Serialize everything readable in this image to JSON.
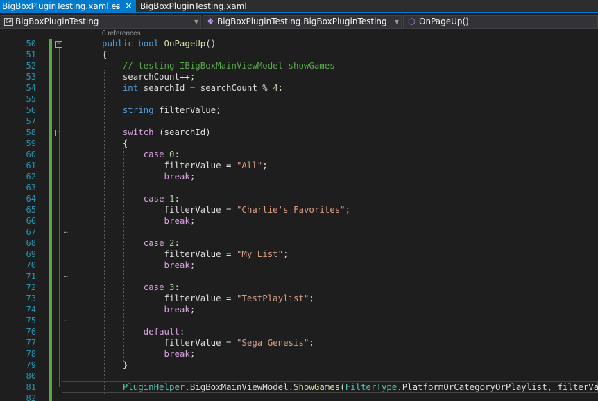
{
  "tabs": [
    {
      "label": "BigBoxPluginTesting.xaml.cs",
      "active": true,
      "pin_glyph": "⊸",
      "close_glyph": "✕"
    },
    {
      "label": "BigBoxPluginTesting.xaml",
      "active": false
    }
  ],
  "navbar": {
    "project": {
      "icon": "csharp-project-icon",
      "icon_text": "C#",
      "label": "BigBoxPluginTesting"
    },
    "type": {
      "icon": "class-icon",
      "label": "BigBoxPluginTesting.BigBoxPluginTesting"
    },
    "member": {
      "icon": "method-icon",
      "label": "OnPageUp()"
    }
  },
  "editor": {
    "references_label": "0 references",
    "lines": [
      {
        "n": "50",
        "tokens": [
          {
            "t": "public",
            "c": "kw"
          },
          {
            "t": " ",
            "c": "pl"
          },
          {
            "t": "bool",
            "c": "kw"
          },
          {
            "t": " ",
            "c": "pl"
          },
          {
            "t": "OnPageUp",
            "c": "fn"
          },
          {
            "t": "()",
            "c": "pl"
          }
        ]
      },
      {
        "n": "51",
        "tokens": [
          {
            "t": "{",
            "c": "pl"
          }
        ]
      },
      {
        "n": "52",
        "tokens": [
          {
            "t": "    // testing IBigBoxMainViewModel showGames",
            "c": "cm"
          }
        ]
      },
      {
        "n": "53",
        "tokens": [
          {
            "t": "    searchCount++;",
            "c": "pl"
          }
        ]
      },
      {
        "n": "54",
        "tokens": [
          {
            "t": "    ",
            "c": "pl"
          },
          {
            "t": "int",
            "c": "kw"
          },
          {
            "t": " searchId = searchCount % ",
            "c": "pl"
          },
          {
            "t": "4",
            "c": "num"
          },
          {
            "t": ";",
            "c": "pl"
          }
        ]
      },
      {
        "n": "55",
        "tokens": []
      },
      {
        "n": "56",
        "tokens": [
          {
            "t": "    ",
            "c": "pl"
          },
          {
            "t": "string",
            "c": "kw"
          },
          {
            "t": " filterValue;",
            "c": "pl"
          }
        ]
      },
      {
        "n": "57",
        "tokens": []
      },
      {
        "n": "58",
        "tokens": [
          {
            "t": "    ",
            "c": "pl"
          },
          {
            "t": "switch",
            "c": "ctl"
          },
          {
            "t": " (searchId)",
            "c": "pl"
          }
        ]
      },
      {
        "n": "59",
        "tokens": [
          {
            "t": "    {",
            "c": "pl"
          }
        ]
      },
      {
        "n": "60",
        "tokens": [
          {
            "t": "        ",
            "c": "pl"
          },
          {
            "t": "case",
            "c": "ctl"
          },
          {
            "t": " ",
            "c": "pl"
          },
          {
            "t": "0",
            "c": "num"
          },
          {
            "t": ":",
            "c": "pl"
          }
        ]
      },
      {
        "n": "61",
        "tokens": [
          {
            "t": "            filterValue = ",
            "c": "pl"
          },
          {
            "t": "\"All\"",
            "c": "str"
          },
          {
            "t": ";",
            "c": "pl"
          }
        ]
      },
      {
        "n": "62",
        "tokens": [
          {
            "t": "            ",
            "c": "pl"
          },
          {
            "t": "break",
            "c": "ctl"
          },
          {
            "t": ";",
            "c": "pl"
          }
        ]
      },
      {
        "n": "63",
        "tokens": []
      },
      {
        "n": "64",
        "tokens": [
          {
            "t": "        ",
            "c": "pl"
          },
          {
            "t": "case",
            "c": "ctl"
          },
          {
            "t": " ",
            "c": "pl"
          },
          {
            "t": "1",
            "c": "num"
          },
          {
            "t": ":",
            "c": "pl"
          }
        ]
      },
      {
        "n": "65",
        "tokens": [
          {
            "t": "            filterValue = ",
            "c": "pl"
          },
          {
            "t": "\"Charlie's Favorites\"",
            "c": "str"
          },
          {
            "t": ";",
            "c": "pl"
          }
        ]
      },
      {
        "n": "66",
        "tokens": [
          {
            "t": "            ",
            "c": "pl"
          },
          {
            "t": "break",
            "c": "ctl"
          },
          {
            "t": ";",
            "c": "pl"
          }
        ]
      },
      {
        "n": "67",
        "tokens": []
      },
      {
        "n": "68",
        "tokens": [
          {
            "t": "        ",
            "c": "pl"
          },
          {
            "t": "case",
            "c": "ctl"
          },
          {
            "t": " ",
            "c": "pl"
          },
          {
            "t": "2",
            "c": "num"
          },
          {
            "t": ":",
            "c": "pl"
          }
        ]
      },
      {
        "n": "69",
        "tokens": [
          {
            "t": "            filterValue = ",
            "c": "pl"
          },
          {
            "t": "\"My List\"",
            "c": "str"
          },
          {
            "t": ";",
            "c": "pl"
          }
        ]
      },
      {
        "n": "70",
        "tokens": [
          {
            "t": "            ",
            "c": "pl"
          },
          {
            "t": "break",
            "c": "ctl"
          },
          {
            "t": ";",
            "c": "pl"
          }
        ]
      },
      {
        "n": "71",
        "tokens": []
      },
      {
        "n": "72",
        "tokens": [
          {
            "t": "        ",
            "c": "pl"
          },
          {
            "t": "case",
            "c": "ctl"
          },
          {
            "t": " ",
            "c": "pl"
          },
          {
            "t": "3",
            "c": "num"
          },
          {
            "t": ":",
            "c": "pl"
          }
        ]
      },
      {
        "n": "73",
        "tokens": [
          {
            "t": "            filterValue = ",
            "c": "pl"
          },
          {
            "t": "\"TestPlaylist\"",
            "c": "str"
          },
          {
            "t": ";",
            "c": "pl"
          }
        ]
      },
      {
        "n": "74",
        "tokens": [
          {
            "t": "            ",
            "c": "pl"
          },
          {
            "t": "break",
            "c": "ctl"
          },
          {
            "t": ";",
            "c": "pl"
          }
        ]
      },
      {
        "n": "75",
        "tokens": []
      },
      {
        "n": "76",
        "tokens": [
          {
            "t": "        ",
            "c": "pl"
          },
          {
            "t": "default",
            "c": "ctl"
          },
          {
            "t": ":",
            "c": "pl"
          }
        ]
      },
      {
        "n": "77",
        "tokens": [
          {
            "t": "            filterValue = ",
            "c": "pl"
          },
          {
            "t": "\"Sega Genesis\"",
            "c": "str"
          },
          {
            "t": ";",
            "c": "pl"
          }
        ]
      },
      {
        "n": "78",
        "tokens": [
          {
            "t": "            ",
            "c": "pl"
          },
          {
            "t": "break",
            "c": "ctl"
          },
          {
            "t": ";",
            "c": "pl"
          }
        ]
      },
      {
        "n": "79",
        "tokens": [
          {
            "t": "    }",
            "c": "pl"
          }
        ]
      },
      {
        "n": "80",
        "tokens": []
      },
      {
        "n": "81",
        "tokens": [
          {
            "t": "    ",
            "c": "pl"
          },
          {
            "t": "PluginHelper",
            "c": "tp"
          },
          {
            "t": ".BigBoxMainViewModel.",
            "c": "pl"
          },
          {
            "t": "ShowGames",
            "c": "fn"
          },
          {
            "t": "(",
            "c": "pl"
          },
          {
            "t": "FilterType",
            "c": "tp"
          },
          {
            "t": ".PlatformOrCategoryOrPlaylist, filterValue);",
            "c": "pl"
          }
        ]
      },
      {
        "n": "82",
        "tokens": []
      }
    ]
  }
}
